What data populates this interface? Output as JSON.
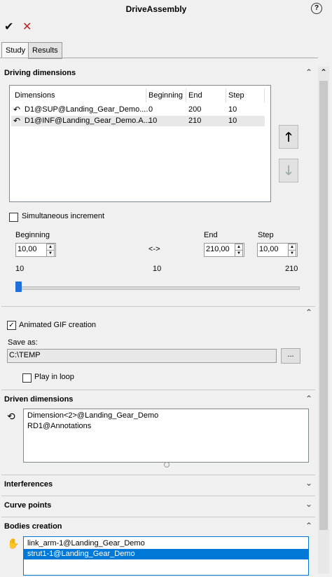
{
  "header": {
    "title": "DriveAssembly",
    "help_icon": "?",
    "ok_icon": "✔",
    "cancel_icon": "✕"
  },
  "tabs": [
    {
      "label": "Study",
      "active": true
    },
    {
      "label": "Results",
      "active": false
    }
  ],
  "driving": {
    "title": "Driving dimensions",
    "columns": [
      "Dimensions",
      "Beginning",
      "End",
      "Step"
    ],
    "rows": [
      {
        "name": "D1@SUP@Landing_Gear_Demo....",
        "beginning": "0",
        "end": "200",
        "step": "10"
      },
      {
        "name": "D1@INF@Landing_Gear_Demo.A...",
        "beginning": "10",
        "end": "210",
        "step": "10"
      }
    ],
    "simultaneous_label": "Simultaneous increment",
    "beginning_label": "Beginning",
    "end_label": "End",
    "step_label": "Step",
    "arrow_label": "<->",
    "beginning_value": "10,00",
    "end_value": "210,00",
    "step_value": "10,00",
    "slider_min_label": "10",
    "slider_mid_label": "10",
    "slider_max_label": "210",
    "slider_value": 0
  },
  "gif": {
    "label": "Animated GIF creation",
    "checked": true,
    "save_as_label": "Save as:",
    "path": "C:\\TEMP",
    "browse_label": "...",
    "loop_label": "Play in loop",
    "loop_checked": false
  },
  "driven": {
    "title": "Driven dimensions",
    "items": [
      "Dimension<2>@Landing_Gear_Demo",
      "RD1@Annotations"
    ]
  },
  "sections": {
    "interferences": "Interferences",
    "curve_points": "Curve points",
    "bodies_creation": "Bodies creation"
  },
  "bodies": {
    "items": [
      "link_arm-1@Landing_Gear_Demo",
      "strut1-1@Landing_Gear_Demo"
    ],
    "selected_index": 1
  },
  "colors": {
    "selection": "#0078d7",
    "slider_thumb": "#1e6fd9"
  }
}
